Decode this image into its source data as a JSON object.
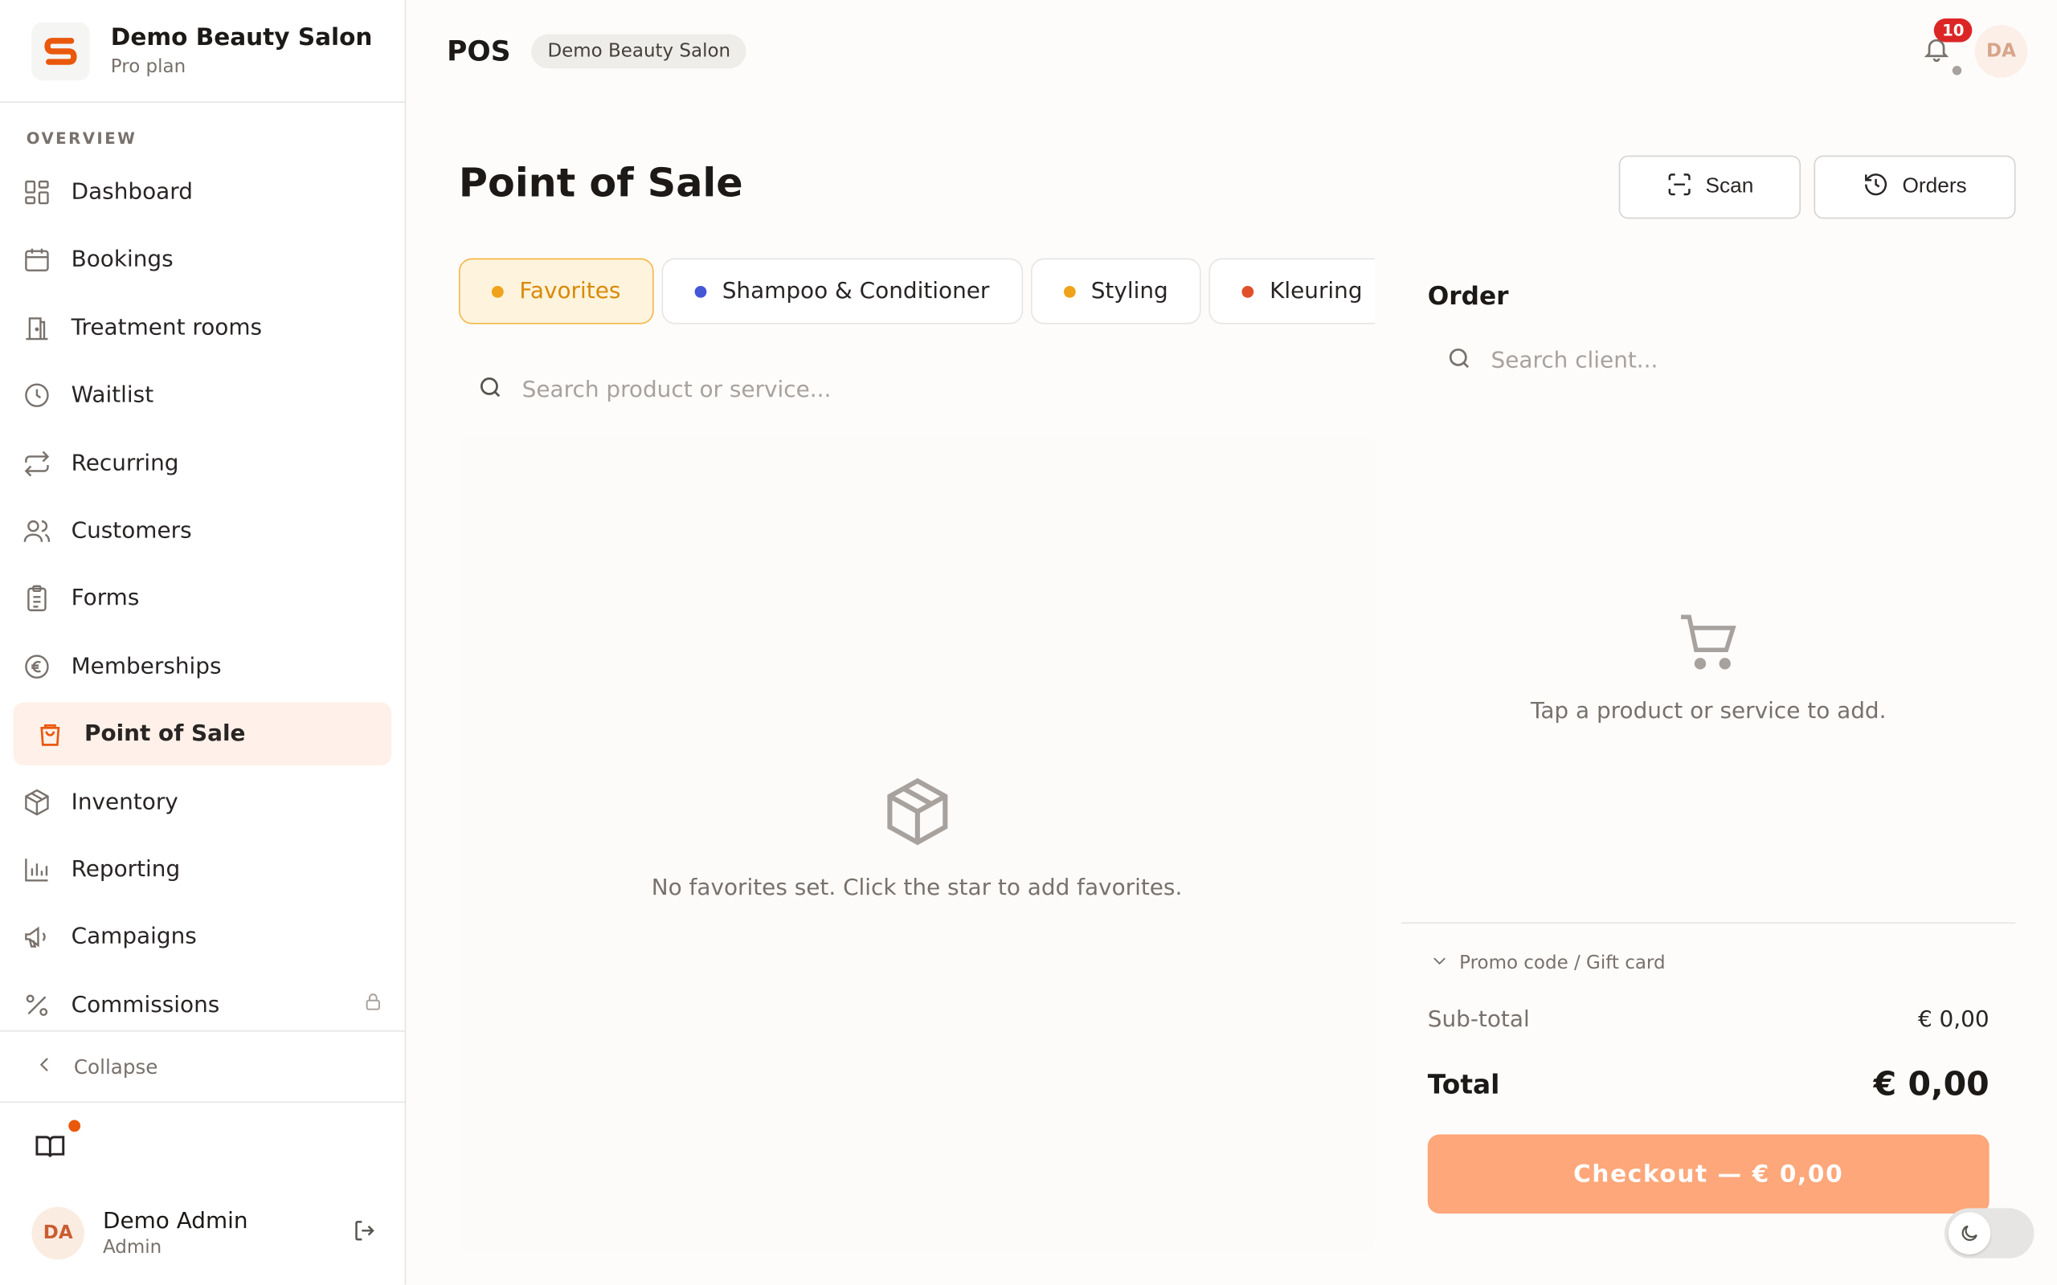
{
  "brand": {
    "name": "Demo Beauty Salon",
    "plan": "Pro plan",
    "logo_letter": "S"
  },
  "nav": {
    "heading": "OVERVIEW",
    "items": [
      {
        "label": "Dashboard",
        "icon": "dashboard-icon"
      },
      {
        "label": "Bookings",
        "icon": "calendar-icon"
      },
      {
        "label": "Treatment rooms",
        "icon": "door-icon"
      },
      {
        "label": "Waitlist",
        "icon": "clock-icon"
      },
      {
        "label": "Recurring",
        "icon": "repeat-icon"
      },
      {
        "label": "Customers",
        "icon": "users-icon"
      },
      {
        "label": "Forms",
        "icon": "clipboard-icon"
      },
      {
        "label": "Memberships",
        "icon": "euro-badge-icon"
      },
      {
        "label": "Point of Sale",
        "icon": "shopping-bag-icon",
        "active": true
      },
      {
        "label": "Inventory",
        "icon": "package-icon"
      },
      {
        "label": "Reporting",
        "icon": "bar-chart-icon"
      },
      {
        "label": "Campaigns",
        "icon": "megaphone-icon"
      },
      {
        "label": "Commissions",
        "icon": "percent-icon",
        "locked": true
      }
    ],
    "collapse_label": "Collapse"
  },
  "user": {
    "initials": "DA",
    "name": "Demo Admin",
    "role": "Admin"
  },
  "topbar": {
    "title": "POS",
    "badge": "Demo Beauty Salon",
    "notification_count": "10",
    "avatar_initials": "DA"
  },
  "main": {
    "title": "Point of Sale",
    "scan_label": "Scan",
    "orders_label": "Orders",
    "categories": [
      {
        "label": "Favorites",
        "color": "#f0a31a",
        "active": true
      },
      {
        "label": "Shampoo & Conditioner",
        "color": "#4457d9"
      },
      {
        "label": "Styling",
        "color": "#f0a31a"
      },
      {
        "label": "Kleuring",
        "color": "#e0502a"
      }
    ],
    "search_placeholder": "Search product or service...",
    "empty_text": "No favorites set. Click the star to add favorites."
  },
  "order": {
    "title": "Order",
    "client_placeholder": "Search client...",
    "empty_text": "Tap a product or service to add.",
    "promo_label": "Promo code / Gift card",
    "subtotal_label": "Sub-total",
    "subtotal_value": "€ 0,00",
    "total_label": "Total",
    "total_value": "€ 0,00",
    "checkout_label": "Checkout — € 0,00"
  },
  "colors": {
    "accent": "#ea580c",
    "checkout": "#fda77a",
    "active_nav_bg": "#fff1e9"
  }
}
